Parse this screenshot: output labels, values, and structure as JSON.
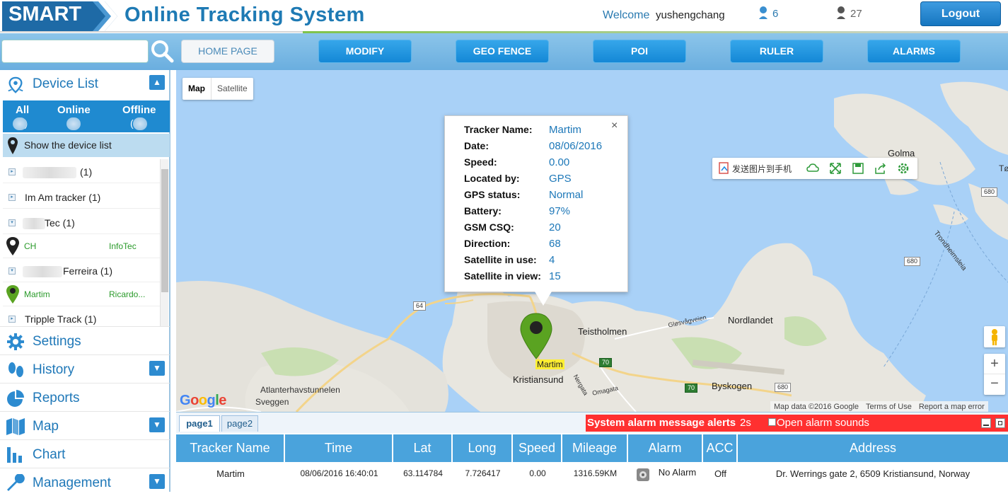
{
  "header": {
    "logo_text": "SMART",
    "title": "Online Tracking System",
    "welcome_label": "Welcome",
    "username": "yushengchang",
    "online_count": "6",
    "offline_count": "27",
    "logout_label": "Logout"
  },
  "nav": {
    "search_placeholder": "",
    "buttons": [
      "HOME PAGE",
      "MODIFY",
      "GEO FENCE",
      "POI",
      "RULER",
      "ALARMS"
    ]
  },
  "sidebar": {
    "device_list_title": "Device List",
    "tabs": [
      {
        "label": "All",
        "count": "(3)"
      },
      {
        "label": "Online",
        "count": "( )"
      },
      {
        "label": "Offline",
        "count": "( )"
      }
    ],
    "show_list_label": "Show the device list",
    "devices": [
      {
        "name": "(1)",
        "blurred": true
      },
      {
        "name": "Im Am tracker  (1)"
      },
      {
        "name": "Tec (1)"
      },
      {
        "child": "CH",
        "owner": "InfoTec"
      },
      {
        "name": "Ferreira  (1)"
      },
      {
        "child": "Martim",
        "owner": "Ricardo..."
      },
      {
        "name": "Tripple Track (1)"
      }
    ],
    "menu": [
      "Settings",
      "History",
      "Reports",
      "Map",
      "Chart",
      "Management"
    ]
  },
  "map": {
    "type_buttons": [
      "Map",
      "Satellite"
    ],
    "info": {
      "labels": [
        "Tracker Name:",
        "Date:",
        "Speed:",
        "Located by:",
        "GPS status:",
        "Battery:",
        "GSM CSQ:",
        "Direction:",
        "Satellite in use:",
        "Satellite in view:"
      ],
      "values": [
        "Martim",
        "08/06/2016",
        "0.00",
        "GPS",
        "Normal",
        "97%",
        "20",
        "68",
        "4",
        "15"
      ],
      "close": "×"
    },
    "toolbar_text": "发送图片到手机",
    "marker_label": "Martim",
    "place_labels": {
      "kristiansund": "Kristiansund",
      "teistholmen": "Teistholmen",
      "nordlandet": "Nordlandet",
      "byskogen": "Byskogen",
      "atlanterhav": "Atlanterhavstunnelen",
      "sveggen": "Sveggen",
      "golma": "Golma",
      "trondheim": "Trondheimsleia",
      "glosvag": "Gløsvågveien",
      "omagata": "Omagata",
      "nergata": "Nergata",
      "to": "Tø"
    },
    "road_shields": [
      "64",
      "70",
      "70",
      "680",
      "680",
      "680"
    ],
    "attribution": [
      "Map data ©2016 Google",
      "Terms of Use",
      "Report a map error"
    ],
    "google_logo": "Google",
    "zoom_in": "+",
    "zoom_out": "−"
  },
  "bottom": {
    "tabs": [
      "page1",
      "page2"
    ],
    "alarm_title": "System alarm message alerts",
    "alarm_seconds": "2s",
    "alarm_sound_label": "Open alarm sounds",
    "columns": [
      "Tracker Name",
      "Time",
      "Lat",
      "Long",
      "Speed",
      "Mileage",
      "Alarm",
      "ACC",
      "Address"
    ],
    "rows": [
      [
        "Martim",
        "08/06/2016 16:40:01",
        "63.114784",
        "7.726417",
        "0.00",
        "1316.59KM",
        "No Alarm",
        "Off",
        "Dr. Werrings gate 2, 6509 Kristiansund, Norway"
      ]
    ]
  },
  "colors": {
    "brand_blue": "#1e7ab4",
    "nav_button": "#1488d6",
    "alarm_red": "#ff3030",
    "table_header": "#4aa3dc",
    "marker_green": "#5aa321"
  }
}
